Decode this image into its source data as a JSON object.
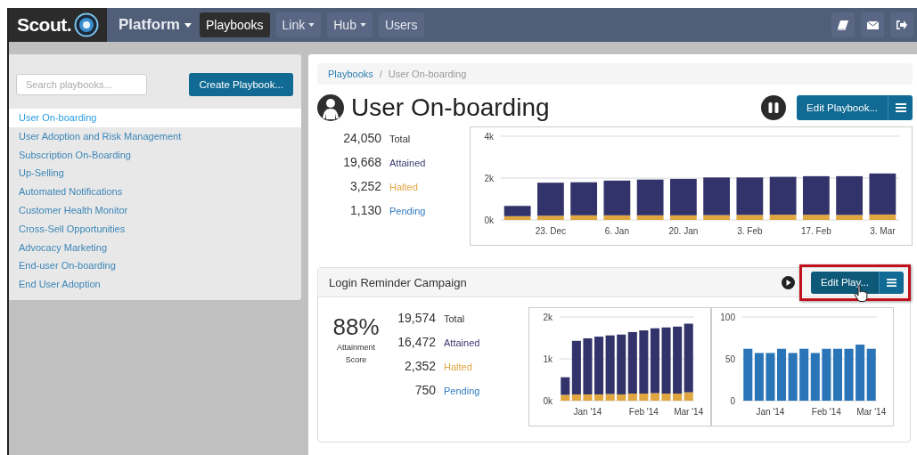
{
  "nav": {
    "logo": "Scout.",
    "product": "Platform",
    "items": [
      {
        "label": "Playbooks",
        "selected": true,
        "has_menu": false
      },
      {
        "label": "Link",
        "selected": false,
        "has_menu": true
      },
      {
        "label": "Hub",
        "selected": false,
        "has_menu": true
      },
      {
        "label": "Users",
        "selected": false,
        "has_menu": false
      }
    ]
  },
  "sidebar": {
    "search": {
      "placeholder": "Search playbooks..."
    },
    "create_button": "Create Playbook...",
    "items": [
      {
        "label": "User On-boarding",
        "selected": true
      },
      {
        "label": "User Adoption and Risk Management",
        "selected": false
      },
      {
        "label": "Subscription On-Boarding",
        "selected": false
      },
      {
        "label": "Up-Selling",
        "selected": false
      },
      {
        "label": "Automated Notifications",
        "selected": false
      },
      {
        "label": "Customer Health Monitor",
        "selected": false
      },
      {
        "label": "Cross-Sell Opportunities",
        "selected": false
      },
      {
        "label": "Advocacy Marketing",
        "selected": false
      },
      {
        "label": "End-user On-boarding",
        "selected": false
      },
      {
        "label": "End User Adoption",
        "selected": false
      }
    ]
  },
  "breadcrumb": {
    "separator": "/",
    "items": [
      {
        "label": "Playbooks",
        "kind": "link"
      },
      {
        "label": "User On-boarding",
        "kind": "current"
      }
    ]
  },
  "playbook": {
    "title": "User On-boarding",
    "edit_button": "Edit Playbook...",
    "stats": [
      {
        "value": "24,050",
        "label": "Total",
        "kind": "total"
      },
      {
        "value": "19,668",
        "label": "Attained",
        "kind": "attained"
      },
      {
        "value": "3,252",
        "label": "Halted",
        "kind": "halted"
      },
      {
        "value": "1,130",
        "label": "Pending",
        "kind": "pending"
      }
    ],
    "chart_data": {
      "type": "bar",
      "stacked": true,
      "categories": [
        null,
        "23. Dec",
        null,
        "6. Jan",
        null,
        "20. Jan",
        null,
        "3. Feb",
        null,
        "17. Feb",
        null,
        "3. Mar"
      ],
      "ylim": [
        0,
        4000
      ],
      "yticks": [
        {
          "value": 0,
          "label": "0k"
        },
        {
          "value": 2000,
          "label": "2k"
        },
        {
          "value": 4000,
          "label": "4k"
        }
      ],
      "series": [
        {
          "color": "#e0a640",
          "values": [
            180,
            200,
            220,
            220,
            220,
            220,
            230,
            240,
            250,
            250,
            240,
            260
          ]
        },
        {
          "color": "#33336b",
          "values": [
            490,
            1580,
            1580,
            1660,
            1710,
            1740,
            1800,
            1790,
            1810,
            1840,
            1850,
            1960
          ]
        }
      ]
    }
  },
  "campaign": {
    "title": "Login Reminder Campaign",
    "edit_button": "Edit Play...",
    "highlighted": true,
    "score": "88%",
    "score_label": "Attainment Score",
    "stats": [
      {
        "value": "19,574",
        "label": "Total",
        "kind": "total"
      },
      {
        "value": "16,472",
        "label": "Attained",
        "kind": "attained"
      },
      {
        "value": "2,352",
        "label": "Halted",
        "kind": "halted"
      },
      {
        "value": "750",
        "label": "Pending",
        "kind": "pending"
      }
    ],
    "charts": [
      {
        "chart_data": {
          "type": "bar",
          "stacked": true,
          "categories": [
            null,
            null,
            "Jan '14",
            null,
            null,
            null,
            null,
            "Feb '14",
            null,
            null,
            null,
            "Mar '14"
          ],
          "ylim": [
            0,
            2000
          ],
          "yticks": [
            {
              "value": 0,
              "label": "0k"
            },
            {
              "value": 1000,
              "label": "1k"
            },
            {
              "value": 2000,
              "label": "2k"
            }
          ],
          "series": [
            {
              "color": "#e0a640",
              "values": [
                140,
                150,
                150,
                150,
                160,
                150,
                170,
                170,
                180,
                170,
                170,
                200
              ]
            },
            {
              "color": "#33336b",
              "values": [
                420,
                1280,
                1340,
                1380,
                1400,
                1430,
                1470,
                1510,
                1550,
                1580,
                1600,
                1640
              ]
            }
          ]
        }
      },
      {
        "chart_data": {
          "type": "bar",
          "categories": [
            null,
            null,
            "Jan '14",
            null,
            null,
            null,
            null,
            "Feb '14",
            null,
            null,
            null,
            "Mar '14"
          ],
          "ylim": [
            0,
            100
          ],
          "yticks": [
            0,
            50,
            100
          ],
          "series": [
            {
              "color": "#2a74b8",
              "values": [
                62,
                57,
                57,
                62,
                57,
                62,
                57,
                62,
                62,
                62,
                67,
                62
              ]
            }
          ]
        }
      }
    ]
  }
}
